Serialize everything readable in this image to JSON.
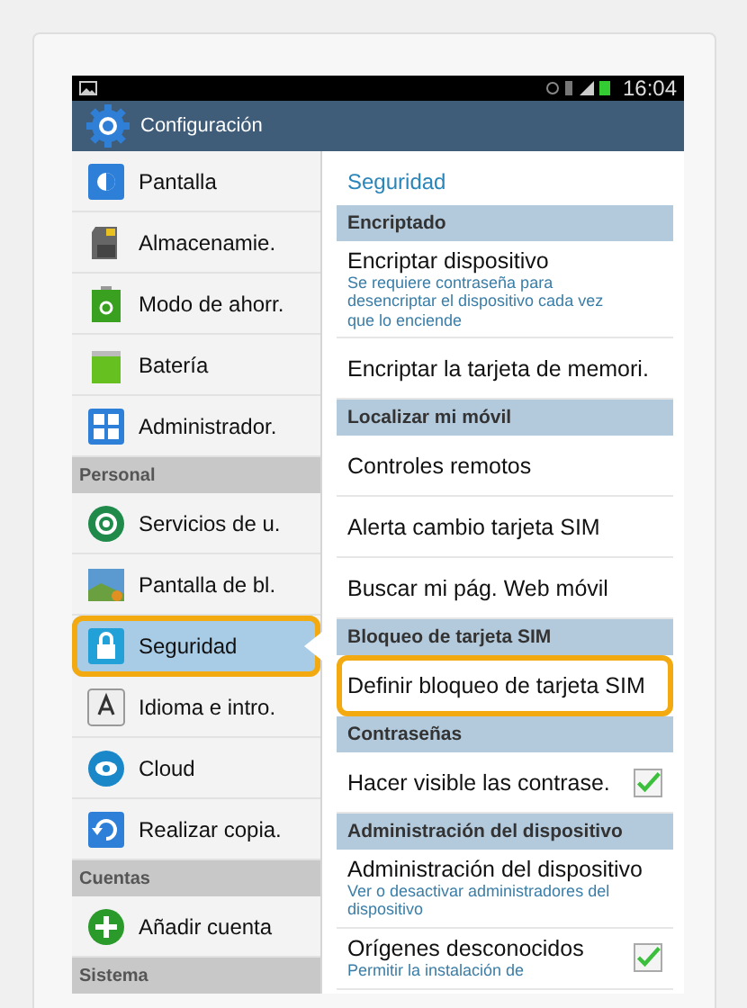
{
  "status_bar": {
    "time": "16:04"
  },
  "action_bar": {
    "title": "Configuración"
  },
  "sidebar": {
    "items": [
      {
        "kind": "item",
        "label": "Pantalla",
        "selected": false,
        "highlighted": false
      },
      {
        "kind": "item",
        "label": "Almacenamie.",
        "selected": false,
        "highlighted": false
      },
      {
        "kind": "item",
        "label": "Modo de ahorr.",
        "selected": false,
        "highlighted": false
      },
      {
        "kind": "item",
        "label": "Batería",
        "selected": false,
        "highlighted": false
      },
      {
        "kind": "item",
        "label": "Administrador.",
        "selected": false,
        "highlighted": false
      },
      {
        "kind": "header",
        "label": "Personal"
      },
      {
        "kind": "item",
        "label": "Servicios de u.",
        "selected": false,
        "highlighted": false
      },
      {
        "kind": "item",
        "label": "Pantalla de bl.",
        "selected": false,
        "highlighted": false
      },
      {
        "kind": "item",
        "label": "Seguridad",
        "selected": true,
        "highlighted": true
      },
      {
        "kind": "item",
        "label": "Idioma e intro.",
        "selected": false,
        "highlighted": false
      },
      {
        "kind": "item",
        "label": "Cloud",
        "selected": false,
        "highlighted": false
      },
      {
        "kind": "item",
        "label": "Realizar copia.",
        "selected": false,
        "highlighted": false
      },
      {
        "kind": "header",
        "label": "Cuentas"
      },
      {
        "kind": "item",
        "label": "Añadir cuenta",
        "selected": false,
        "highlighted": false
      },
      {
        "kind": "header",
        "label": "Sistema"
      }
    ]
  },
  "detail": {
    "title": "Seguridad",
    "rows": [
      {
        "kind": "header",
        "label": "Encriptado"
      },
      {
        "kind": "item",
        "label": "Encriptar dispositivo",
        "summary": "Se requiere contraseña para desencriptar el dispositivo cada vez que lo enciende",
        "highlighted": false
      },
      {
        "kind": "item",
        "label": "Encriptar la tarjeta de memori.",
        "highlighted": false
      },
      {
        "kind": "header",
        "label": "Localizar mi móvil"
      },
      {
        "kind": "item",
        "label": "Controles remotos",
        "highlighted": false
      },
      {
        "kind": "item",
        "label": "Alerta cambio tarjeta SIM",
        "highlighted": false
      },
      {
        "kind": "item",
        "label": "Buscar mi pág. Web móvil",
        "highlighted": false
      },
      {
        "kind": "header",
        "label": "Bloqueo de tarjeta SIM"
      },
      {
        "kind": "item",
        "label": "Definir bloqueo de tarjeta SIM",
        "highlighted": true
      },
      {
        "kind": "header",
        "label": "Contraseñas"
      },
      {
        "kind": "check",
        "label": "Hacer visible las contrase.",
        "checked": true,
        "highlighted": false
      },
      {
        "kind": "header",
        "label": "Administración del dispositivo"
      },
      {
        "kind": "item",
        "label": "Administración del dispositivo",
        "summary": "Ver o desactivar administradores del dispositivo",
        "highlighted": false
      },
      {
        "kind": "check",
        "label": "Orígenes desconocidos",
        "summary": "Permitir la instalación de",
        "checked": true,
        "highlighted": false
      }
    ]
  }
}
